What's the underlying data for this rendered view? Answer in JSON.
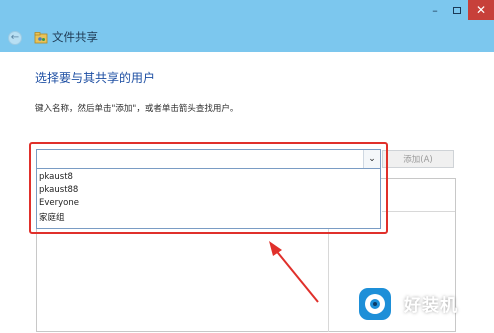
{
  "window": {
    "minimize_glyph": "–",
    "close_glyph": "✕"
  },
  "nav": {
    "back_glyph": "←",
    "title": "文件共享",
    "icon": "share-folder-icon"
  },
  "heading": "选择要与其共享的用户",
  "instruction": "键入名称，然后单击\"添加\"，或者单击箭头查找用户。",
  "combo": {
    "value": "",
    "dropdown_glyph": "⌄"
  },
  "add_button": {
    "label": "添加(A)",
    "enabled": false
  },
  "dropdown_items": [
    "pkaust8",
    "pkaust88",
    "Everyone",
    "家庭组"
  ],
  "annotation": {
    "color": "#e0302b"
  },
  "watermark": {
    "text": "好装机"
  },
  "colors": {
    "titlebar": "#7cc7ee",
    "heading": "#1e4fa3",
    "close": "#c7403a"
  }
}
